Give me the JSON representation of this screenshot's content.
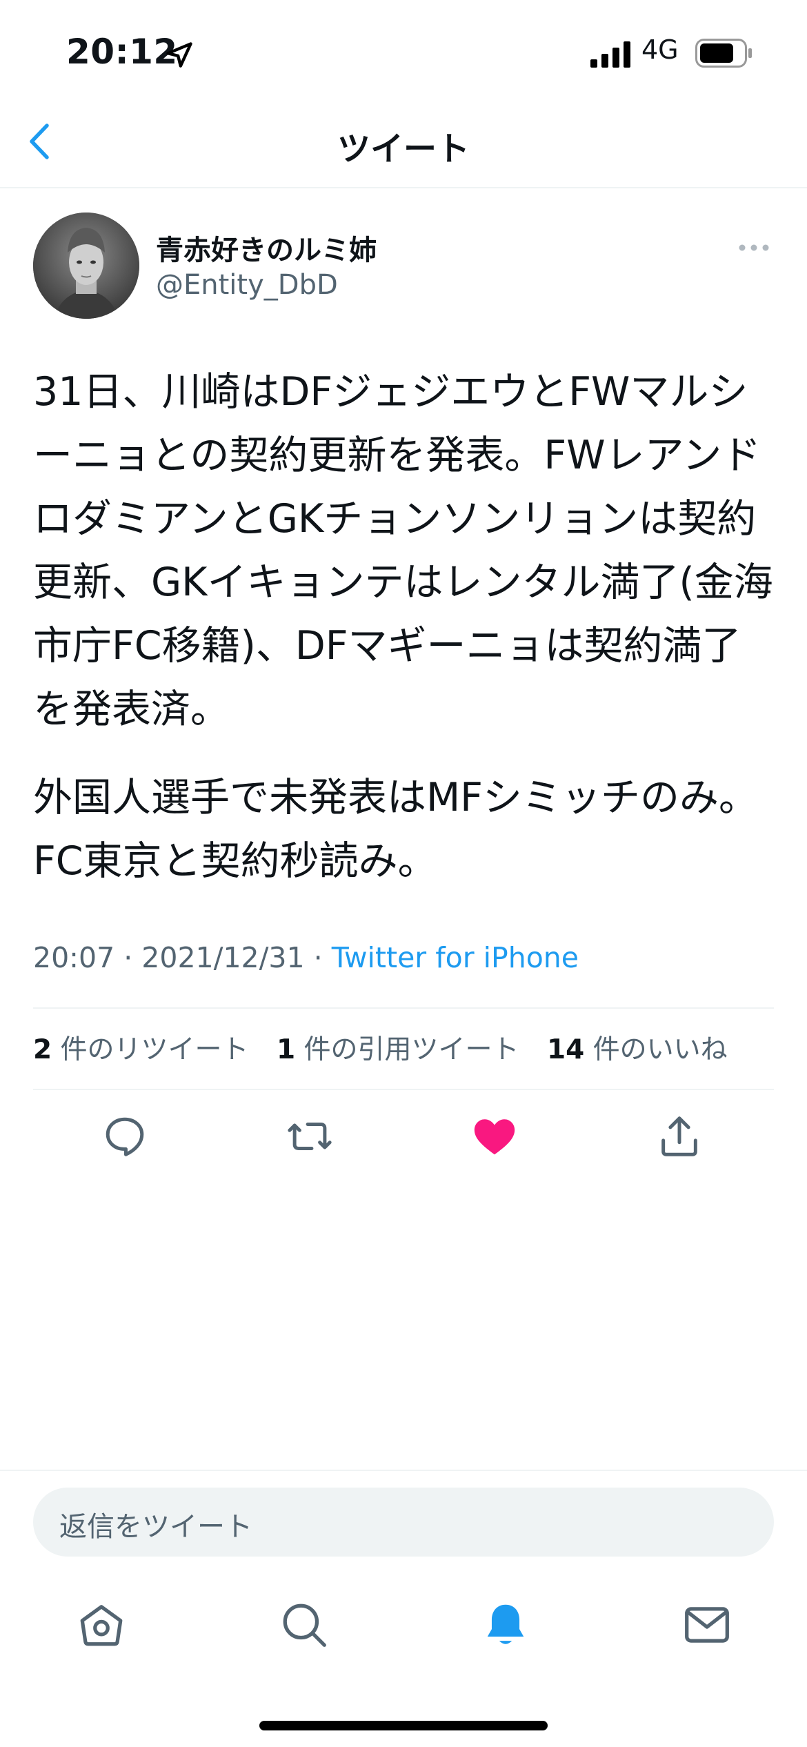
{
  "status_bar": {
    "time": "20:12",
    "network": "4G",
    "icons": [
      "location-arrow-icon",
      "signal-bars-icon",
      "battery-icon"
    ]
  },
  "header": {
    "title": "ツイート",
    "back_icon": "chevron-left-icon"
  },
  "tweet": {
    "author_name": "青赤好きのルミ姉",
    "author_handle": "@Entity_DbD",
    "paragraphs": [
      "31日、川崎はDFジェジエウとFWマルシーニョとの契約更新を発表。FWレアンドロダミアンとGKチョンソンリョンは契約更新、GKイキョンテはレンタル満了(金海市庁FC移籍)、DFマギーニョは契約満了を発表済。",
      "外国人選手で未発表はMFシミッチのみ。FC東京と契約秒読み。"
    ],
    "time": "20:07",
    "date": "2021/12/31",
    "separator": "·",
    "source": "Twitter for iPhone",
    "stats": {
      "retweets_count": "2",
      "retweets_label": "件のリツイート",
      "quotes_count": "1",
      "quotes_label": "件の引用ツイート",
      "likes_count": "14",
      "likes_label": "件のいいね"
    },
    "liked": true
  },
  "actions": [
    "reply-icon",
    "retweet-icon",
    "heart-icon",
    "share-icon"
  ],
  "reply_bar": {
    "placeholder": "返信をツイート"
  },
  "tab_bar": {
    "tabs": [
      "home-icon",
      "search-icon",
      "bell-icon",
      "mail-icon"
    ],
    "active": "bell-icon"
  },
  "colors": {
    "accent": "#1d9bf0",
    "like": "#f91880",
    "muted": "#536471",
    "divider": "#eff3f4"
  }
}
